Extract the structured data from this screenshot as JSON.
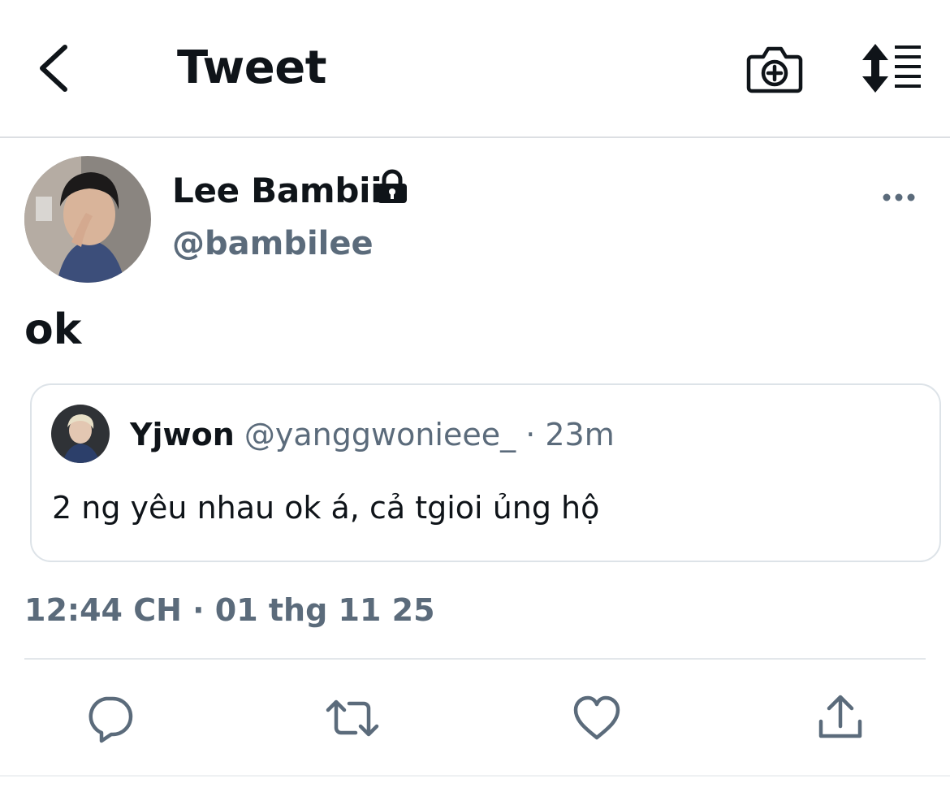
{
  "header": {
    "title": "Tweet"
  },
  "tweet": {
    "display_name": "Lee Bambii",
    "handle": "@bambilee",
    "text": "ok",
    "timestamp": "12:44 CH · 01 thg 11 25"
  },
  "quoted_tweet": {
    "display_name": "Yjwon",
    "handle": "@yanggwonieee_",
    "separator": " · ",
    "age": "23m",
    "text": "2 ng yêu nhau ok á, cả tgioi ủng hộ"
  },
  "icons": {
    "back": "chevron-left-icon",
    "camera": "camera-plus-icon",
    "sort": "sort-lines-icon",
    "lock": "lock-icon",
    "more": "more-dots-icon",
    "reply": "reply-bubble-icon",
    "retweet": "retweet-icon",
    "like": "heart-icon",
    "share": "share-upload-icon"
  },
  "colors": {
    "text_primary": "#0f1419",
    "text_secondary": "#5b6b7b",
    "divider": "#e3e7eb"
  }
}
